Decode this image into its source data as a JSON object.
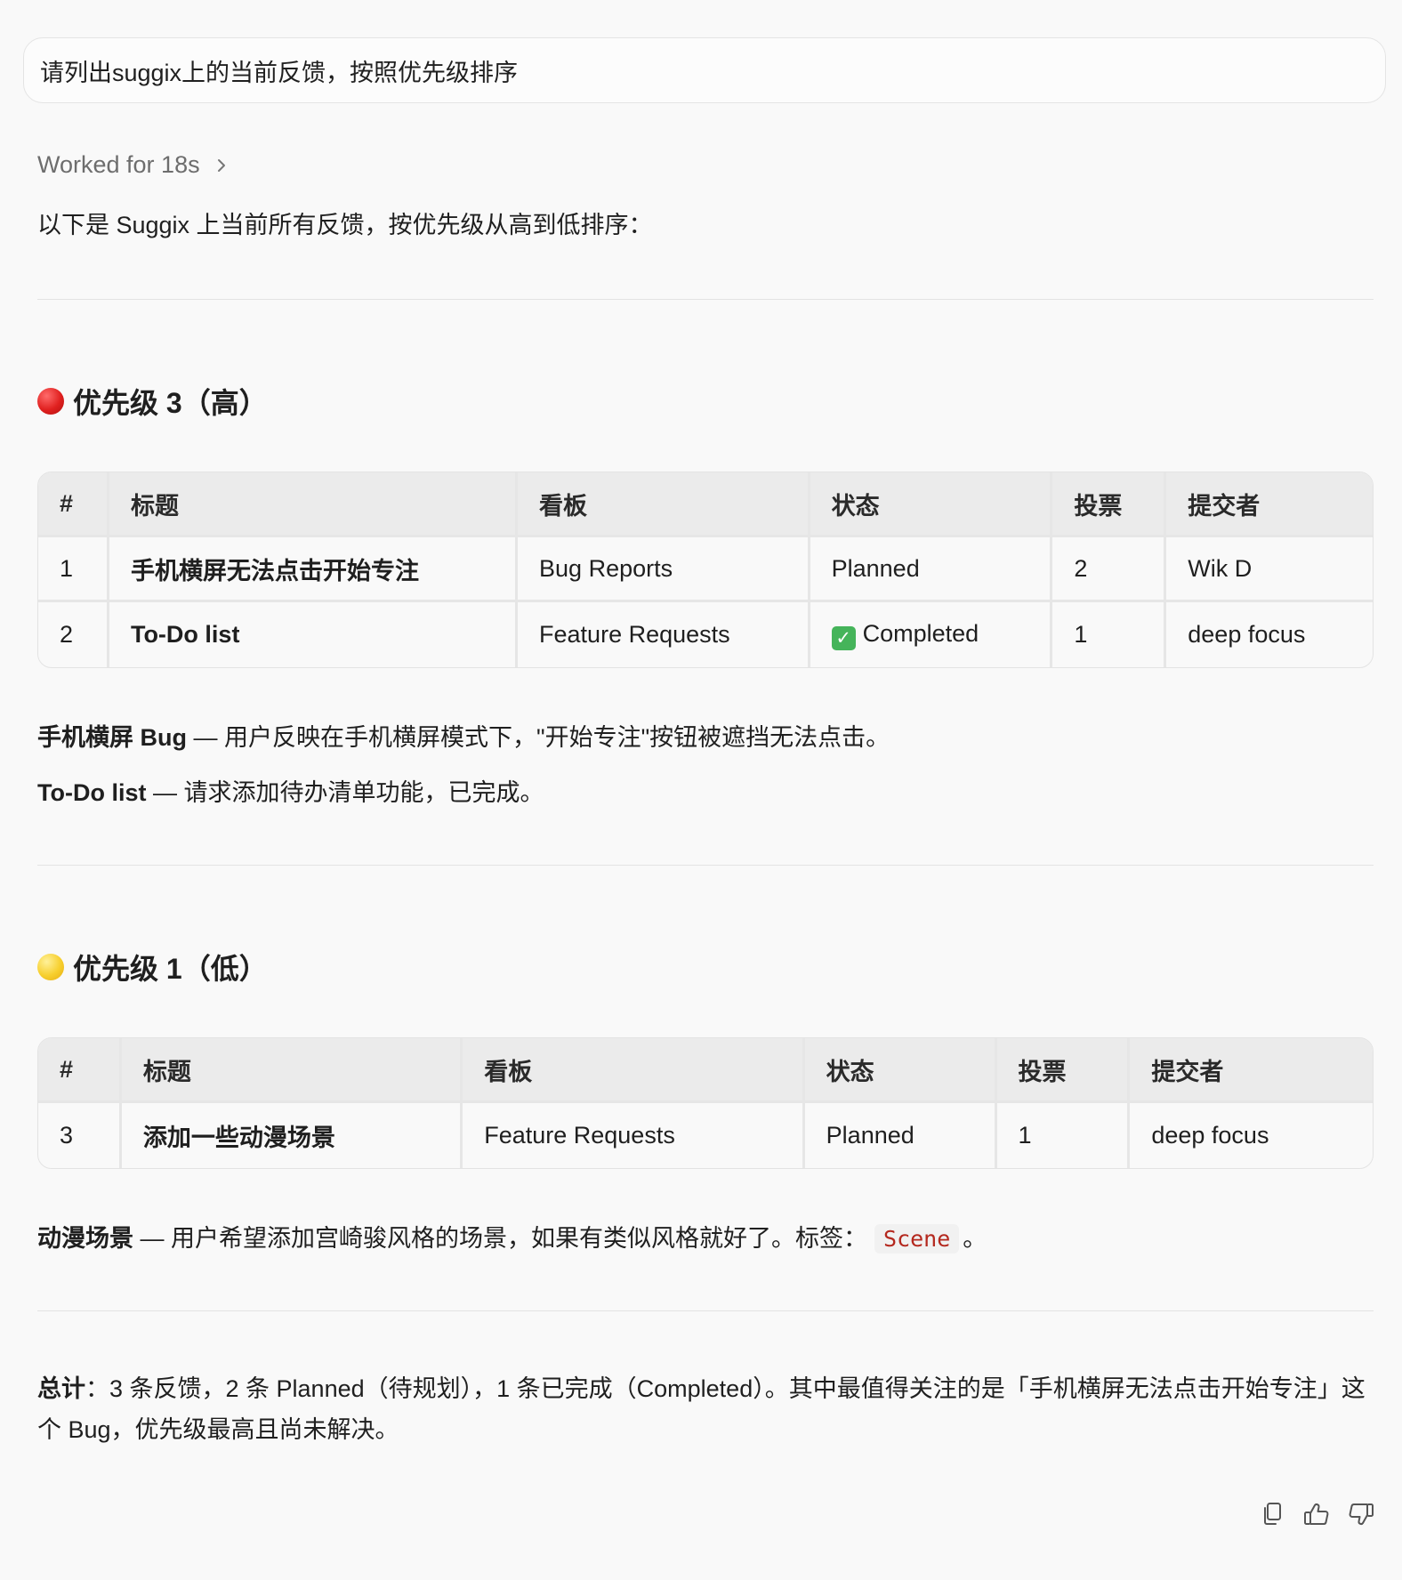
{
  "prompt": "请列出suggix上的当前反馈，按照优先级排序",
  "worked": {
    "label": "Worked for 18s"
  },
  "intro": "以下是 Suggix 上当前所有反馈，按优先级从高到低排序：",
  "high": {
    "title": "优先级 3（高）",
    "color": "#e0201f",
    "headers": [
      "#",
      "标题",
      "看板",
      "状态",
      "投票",
      "提交者"
    ],
    "rows": [
      {
        "num": "1",
        "title": "手机横屏无法点击开始专注",
        "board": "Bug Reports",
        "status": "Planned",
        "status_icon": "",
        "votes": "2",
        "submitter": "Wik D"
      },
      {
        "num": "2",
        "title": "To-Do list",
        "board": "Feature Requests",
        "status": "Completed",
        "status_icon": "check-mark-icon",
        "votes": "1",
        "submitter": "deep focus"
      }
    ],
    "notes": [
      {
        "label": "手机横屏 Bug",
        "text": " — 用户反映在手机横屏模式下，\"开始专注\"按钮被遮挡无法点击。"
      },
      {
        "label": "To-Do list",
        "text": " — 请求添加待办清单功能，已完成。"
      }
    ]
  },
  "low": {
    "title": "优先级 1（低）",
    "color": "#f7cf2d",
    "headers": [
      "#",
      "标题",
      "看板",
      "状态",
      "投票",
      "提交者"
    ],
    "rows": [
      {
        "num": "3",
        "title": "添加一些动漫场景",
        "board": "Feature Requests",
        "status": "Planned",
        "status_icon": "",
        "votes": "1",
        "submitter": "deep focus"
      }
    ],
    "note": {
      "label": "动漫场景",
      "text": " — 用户希望添加宫崎骏风格的场景，如果有类似风格就好了。标签：",
      "tag": "Scene",
      "end": "。"
    }
  },
  "summary": {
    "label": "总计",
    "text": "：3 条反馈，2 条 Planned（待规划），1 条已完成（Completed）。其中最值得关注的是「手机横屏无法点击开始专注」这个 Bug，优先级最高且尚未解决。"
  },
  "actions": [
    "copy-icon",
    "thumbs-up-icon",
    "thumbs-down-icon"
  ]
}
